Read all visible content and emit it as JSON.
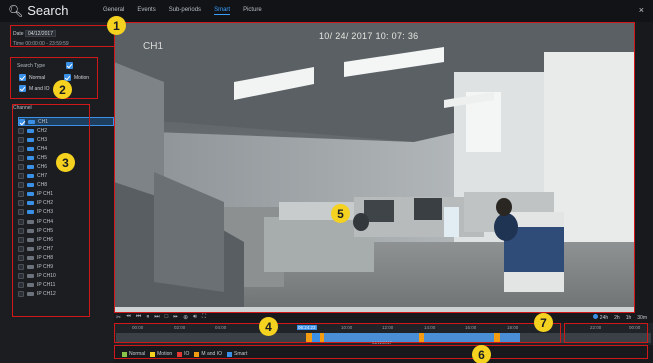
{
  "window": {
    "title": "Search",
    "close_glyph": "×"
  },
  "tabs": [
    {
      "label": "General",
      "active": false
    },
    {
      "label": "Events",
      "active": false
    },
    {
      "label": "Sub-periods",
      "active": false
    },
    {
      "label": "Smart",
      "active": true
    },
    {
      "label": "Picture",
      "active": false
    }
  ],
  "filters": {
    "date_label": "Date",
    "date_value": "04/12/2017",
    "time_label": "Time",
    "time_start": "00:00:00",
    "time_sep": "-",
    "time_end": "23:59:59",
    "search_type_label": "Search Type",
    "types": [
      {
        "label": "Normal",
        "checked": true
      },
      {
        "label": "Motion",
        "checked": true
      },
      {
        "label": "M and IO",
        "checked": true
      }
    ]
  },
  "channel": {
    "label": "Channel",
    "items": [
      {
        "label": "CH1",
        "checked": true,
        "selected": true,
        "active": true
      },
      {
        "label": "CH2",
        "checked": false,
        "selected": false,
        "active": true
      },
      {
        "label": "CH3",
        "checked": false,
        "selected": false,
        "active": true
      },
      {
        "label": "CH4",
        "checked": false,
        "selected": false,
        "active": true
      },
      {
        "label": "CH5",
        "checked": false,
        "selected": false,
        "active": true
      },
      {
        "label": "CH6",
        "checked": false,
        "selected": false,
        "active": true
      },
      {
        "label": "CH7",
        "checked": false,
        "selected": false,
        "active": true
      },
      {
        "label": "CH8",
        "checked": false,
        "selected": false,
        "active": true
      },
      {
        "label": "IP CH1",
        "checked": false,
        "selected": false,
        "active": true
      },
      {
        "label": "IP CH2",
        "checked": false,
        "selected": false,
        "active": true
      },
      {
        "label": "IP CH3",
        "checked": false,
        "selected": false,
        "active": true
      },
      {
        "label": "IP CH4",
        "checked": false,
        "selected": false,
        "active": false
      },
      {
        "label": "IP CH5",
        "checked": false,
        "selected": false,
        "active": false
      },
      {
        "label": "IP CH6",
        "checked": false,
        "selected": false,
        "active": false
      },
      {
        "label": "IP CH7",
        "checked": false,
        "selected": false,
        "active": false
      },
      {
        "label": "IP CH8",
        "checked": false,
        "selected": false,
        "active": false
      },
      {
        "label": "IP CH9",
        "checked": false,
        "selected": false,
        "active": false
      },
      {
        "label": "IP CH10",
        "checked": false,
        "selected": false,
        "active": false
      },
      {
        "label": "IP CH11",
        "checked": false,
        "selected": false,
        "active": false
      },
      {
        "label": "IP CH12",
        "checked": false,
        "selected": false,
        "active": false
      }
    ]
  },
  "video": {
    "timestamp": "10/ 24/ 2017  10: 07: 36",
    "channel_label": "CH1"
  },
  "playback_controls": [
    "scissors-icon",
    "rewind-icon",
    "prev-frame-icon",
    "pause-icon",
    "next-frame-icon",
    "stop-icon",
    "fast-forward-icon",
    "zoom-icon",
    "volume-icon",
    "fullscreen-icon"
  ],
  "zoom_levels": {
    "options": [
      "24h",
      "2h",
      "1h",
      "30m"
    ],
    "selected": "24h"
  },
  "timeline": {
    "ticks": [
      "00:00",
      "02:00",
      "04:00",
      "06:24:23",
      "10:00",
      "12:00",
      "14:00",
      "16:00",
      "18:00",
      "22:00",
      "00:00"
    ],
    "current_tick": "06:24:23",
    "date_label": "04/12/2017"
  },
  "legend": [
    {
      "label": "Normal",
      "color": "#8bc34a"
    },
    {
      "label": "Motion",
      "color": "#f5d21f"
    },
    {
      "label": "IO",
      "color": "#e53935"
    },
    {
      "label": "M and IO",
      "color": "#f39c12"
    },
    {
      "label": "Smart",
      "color": "#3a8fe6"
    }
  ],
  "annotations": [
    "1",
    "2",
    "3",
    "4",
    "5",
    "6",
    "7"
  ]
}
